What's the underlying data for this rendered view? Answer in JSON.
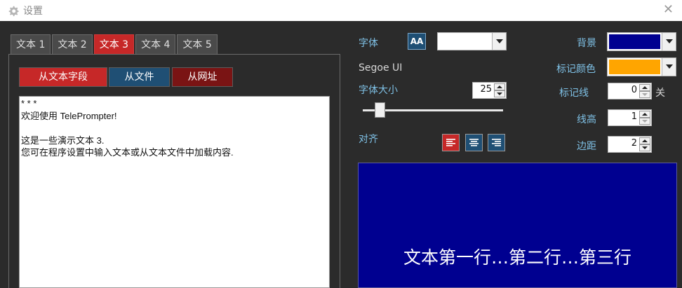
{
  "window": {
    "title": "设置",
    "icon": "gear-icon",
    "close_icon": "close-icon"
  },
  "tabs": [
    {
      "label": "文本 1",
      "active": false
    },
    {
      "label": "文本 2",
      "active": false
    },
    {
      "label": "文本 3",
      "active": true
    },
    {
      "label": "文本 4",
      "active": false
    },
    {
      "label": "文本 5",
      "active": false
    }
  ],
  "source_buttons": {
    "from_field": "从文本字段",
    "from_file": "从文件",
    "from_url": "从网址"
  },
  "text_lines": [
    "* * *",
    "欢迎使用 TelePrompter!",
    "",
    "这是一些演示文本 3.",
    "您可在程序设置中输入文本或从文本文件中加载内容."
  ],
  "font": {
    "label": "字体",
    "button_glyph": "AA",
    "font_name": "Segoe UI",
    "color_value": "#ffffff"
  },
  "font_size": {
    "label": "字体大小",
    "value": "25",
    "slider_fraction": 0.12
  },
  "align": {
    "label": "对齐",
    "options": [
      "align-left",
      "align-center",
      "align-right"
    ],
    "selected": "align-left"
  },
  "background": {
    "label": "背景",
    "color": "#000090"
  },
  "marker_color": {
    "label": "标记颜色",
    "color": "#ffa500"
  },
  "marker_line": {
    "label": "标记线",
    "value": "0",
    "state": "关"
  },
  "line_height": {
    "label": "线高",
    "value": "1"
  },
  "margin": {
    "label": "边距",
    "value": "2"
  },
  "preview": {
    "text": "文本第一行…第二行…第三行"
  },
  "colors": {
    "accent_red": "#c62828",
    "accent_blue": "#1f4f74",
    "label_blue": "#7fc1e6",
    "panel_bg": "#2b2b2b"
  }
}
